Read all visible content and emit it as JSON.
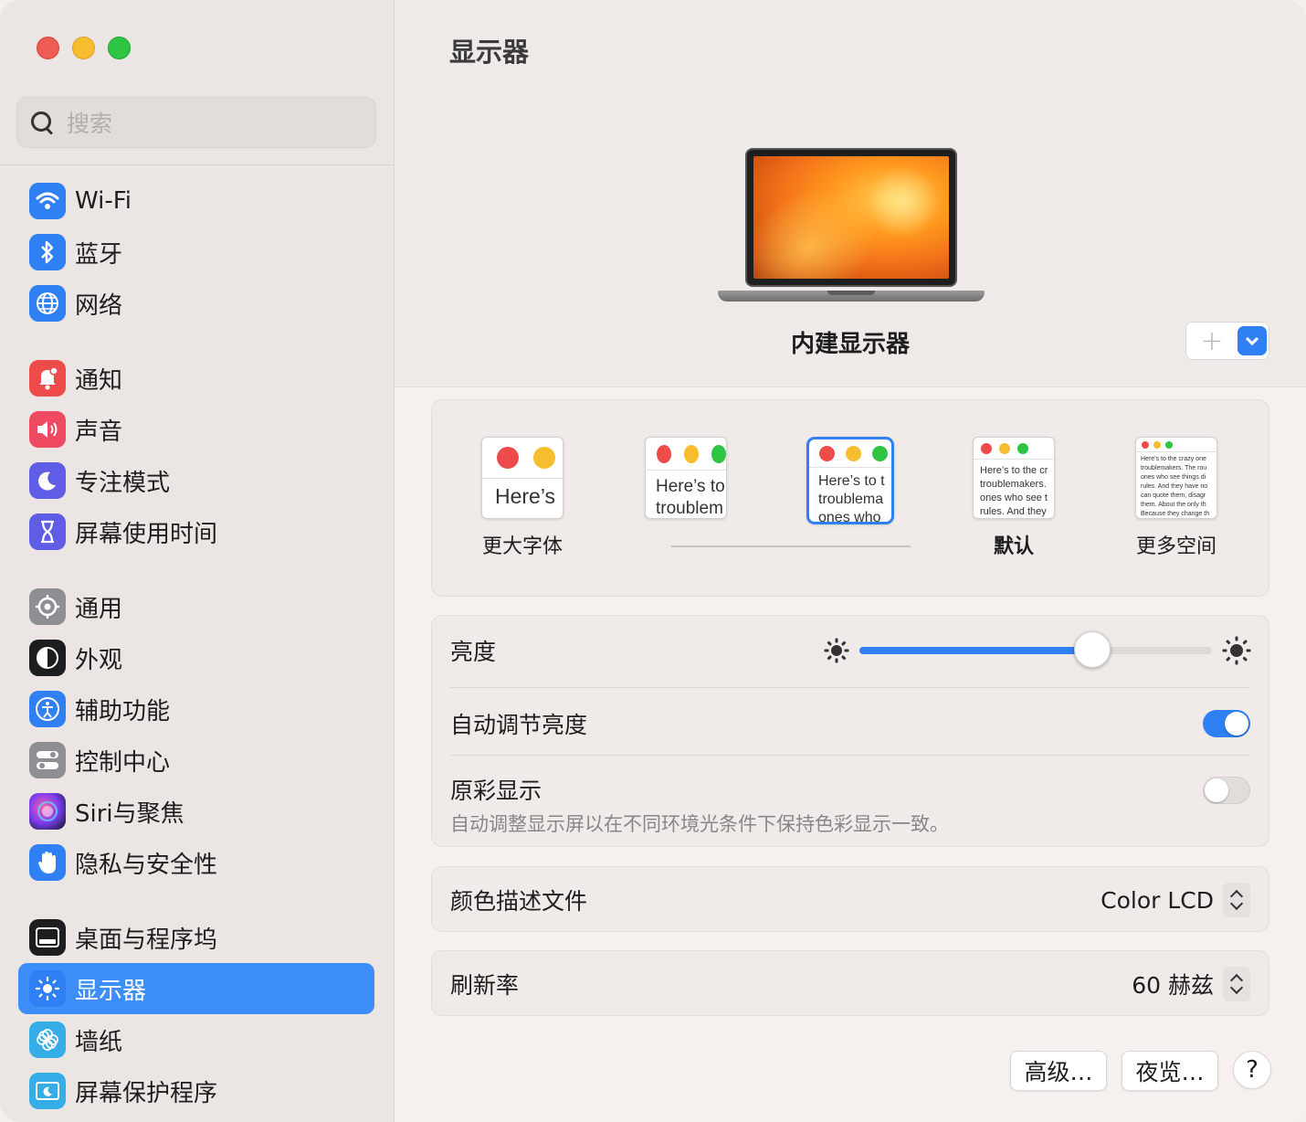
{
  "window": {
    "title": "显示器"
  },
  "search": {
    "placeholder": "搜索"
  },
  "sidebar": {
    "items": [
      {
        "label": "Wi-Fi",
        "icon": "wifi-icon",
        "color": "#2f7ff5"
      },
      {
        "label": "蓝牙",
        "icon": "bluetooth-icon",
        "color": "#2f7ff5"
      },
      {
        "label": "网络",
        "icon": "globe-icon",
        "color": "#2f7ff5"
      },
      {
        "label": "通知",
        "icon": "bell-icon",
        "color": "#ee4b4b"
      },
      {
        "label": "声音",
        "icon": "speaker-icon",
        "color": "#ee4a62"
      },
      {
        "label": "专注模式",
        "icon": "moon-icon",
        "color": "#5f5ce6"
      },
      {
        "label": "屏幕使用时间",
        "icon": "hourglass-icon",
        "color": "#5f5ce6"
      },
      {
        "label": "通用",
        "icon": "gear-icon",
        "color": "#8e8e93"
      },
      {
        "label": "外观",
        "icon": "appearance-icon",
        "color": "#1d1d1f"
      },
      {
        "label": "辅助功能",
        "icon": "accessibility-icon",
        "color": "#2f7ff5"
      },
      {
        "label": "控制中心",
        "icon": "control-center-icon",
        "color": "#8e8e93"
      },
      {
        "label": "Siri与聚焦",
        "icon": "siri-icon",
        "color": "#c03fd6"
      },
      {
        "label": "隐私与安全性",
        "icon": "hand-icon",
        "color": "#2f7ff5"
      },
      {
        "label": "桌面与程序坞",
        "icon": "dock-icon",
        "color": "#1d1d1f"
      },
      {
        "label": "显示器",
        "icon": "display-sun-icon",
        "color": "#2f7ff5",
        "active": true
      },
      {
        "label": "墙纸",
        "icon": "flower-icon",
        "color": "#35aee8"
      },
      {
        "label": "屏幕保护程序",
        "icon": "screensaver-icon",
        "color": "#35aee8"
      }
    ]
  },
  "display": {
    "name": "内建显示器",
    "add_label": "+"
  },
  "text_size": {
    "sample_text": "Here’s to the crazy ones. The misfits. The rebels. The troublemakers. The round pegs in the square holes. The ones who see things differently. They’re not fond of rules. And they have no respect for the status quo. You can quote them, disagree with them. About the only thing you can’t do is ignore them. Because they change things.",
    "options": [
      {
        "label": "更大字体",
        "preview": "Here’s"
      },
      {
        "label": "",
        "preview_line1": "Here’s to",
        "preview_line2": "troublem"
      },
      {
        "label": "",
        "preview_line1": "Here’s to t",
        "preview_line2": "troublema",
        "preview_line3": "ones who"
      },
      {
        "label": "默认",
        "preview_lines": [
          "Here’s to the cr",
          "troublemakers.",
          "ones who see t",
          "rules. And they"
        ]
      },
      {
        "label": "更多空间",
        "preview_lines": [
          "Here’s to the crazy one",
          "troublemakers. The rou",
          "ones who see things di",
          "rules. And they have no",
          "can quote them, disagr",
          "them. About the only th",
          "Because they change th"
        ]
      }
    ],
    "selected_index": 2
  },
  "brightness": {
    "label": "亮度",
    "value": 0.66
  },
  "auto_brightness": {
    "label": "自动调节亮度",
    "enabled": true
  },
  "true_tone": {
    "label": "原彩显示",
    "description": "自动调整显示屏以在不同环境光条件下保持色彩显示一致。",
    "enabled": false
  },
  "color_profile": {
    "label": "颜色描述文件",
    "value": "Color LCD"
  },
  "refresh_rate": {
    "label": "刷新率",
    "value": "60 赫兹"
  },
  "buttons": {
    "advanced": "高级…",
    "night_shift": "夜览…",
    "help": "?"
  }
}
